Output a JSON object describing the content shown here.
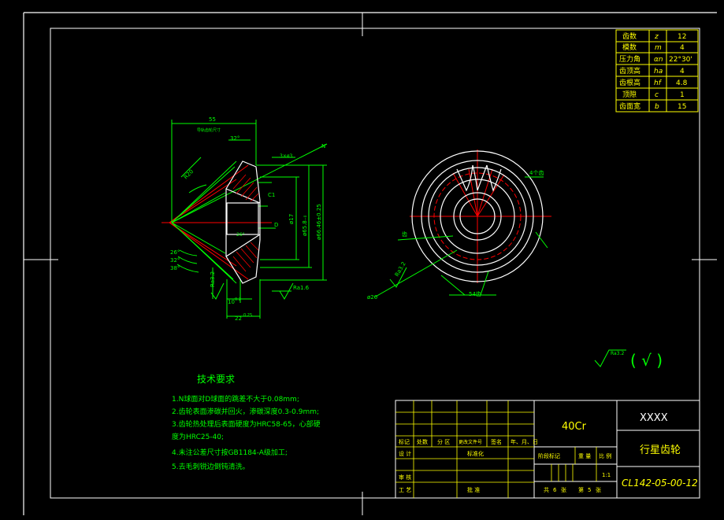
{
  "colors": {
    "frame": "#ffffff",
    "yellow": "#ffff00",
    "green": "#00ff00",
    "red": "#ff0000",
    "white": "#ffffff"
  },
  "param_table": [
    {
      "name": "齿数",
      "sym": "z",
      "val": "12"
    },
    {
      "name": "模数",
      "sym": "m",
      "val": "4"
    },
    {
      "name": "压力角",
      "sym": "αn",
      "val": "22°30'"
    },
    {
      "name": "齿顶高",
      "sym": "ha",
      "val": "4"
    },
    {
      "name": "齿根高",
      "sym": "hf",
      "val": "4.8"
    },
    {
      "name": "顶隙",
      "sym": "c",
      "val": "1"
    },
    {
      "name": "齿面宽",
      "sym": "b",
      "val": "15"
    }
  ],
  "side_view": {
    "dim_55": "55",
    "note_top": "导轨齿轮尺寸",
    "dim_32": "32°",
    "dim_r": "R20",
    "label_N": "N",
    "label_D": "D",
    "label_C1": "C1",
    "dim_d1": "ø17",
    "dim_d2": "ø65.8₋₀",
    "dim_d3": "ø66.46±0.25",
    "dim_3x": "3×ø3",
    "ang1": "26°",
    "ang2": "32°",
    "ang3": "38°",
    "ang_small": "26°",
    "rough1": "Ra3.2",
    "rough2": "Ra1.6",
    "dim_bot1": "10",
    "dim_bot2": "22",
    "tol_bot": "0.25",
    "tol_bot1": "0.2"
  },
  "front_view": {
    "label_top": "4个齿",
    "label_left": "齿",
    "dim_hole": "ø20",
    "rough": "Ra3.2",
    "label_bottom": "54齿"
  },
  "roughness_note": {
    "sym": "Ra3.2",
    "paren": "( √ )"
  },
  "tech_req": {
    "title": "技术要求",
    "items": [
      "1.N球面对D球面的跳差不大于0.08mm;",
      "2.齿轮表面渗碳并回火，渗碳深度0.3-0.9mm;",
      "3.齿轮热处理后表面硬度为HRC58-65，心部硬",
      "  度为HRC25-40;",
      "4.未注公差尺寸按GB1184-A级加工;",
      "5.去毛刺锐边倒钝清洗。"
    ]
  },
  "title_block": {
    "material": "40Cr",
    "company": "XXXX",
    "part_name": "行星齿轮",
    "drawing_no": "CL142-05-00-12",
    "scale": "1:1",
    "row_heads": [
      "标记",
      "处数",
      "分 区",
      "更改文件号",
      "签名",
      "年、月、日"
    ],
    "designer": "设 计",
    "standard": "标准化",
    "checker": "审 核",
    "process": "工 艺",
    "approve": "批 准",
    "stage": "阶段标记",
    "weight": "重 量",
    "ratio": "比 例",
    "total_label_a": "共",
    "total": "6",
    "total_label_b": "张",
    "sheet_label_a": "第",
    "sheet": "5",
    "sheet_label_b": "张"
  }
}
